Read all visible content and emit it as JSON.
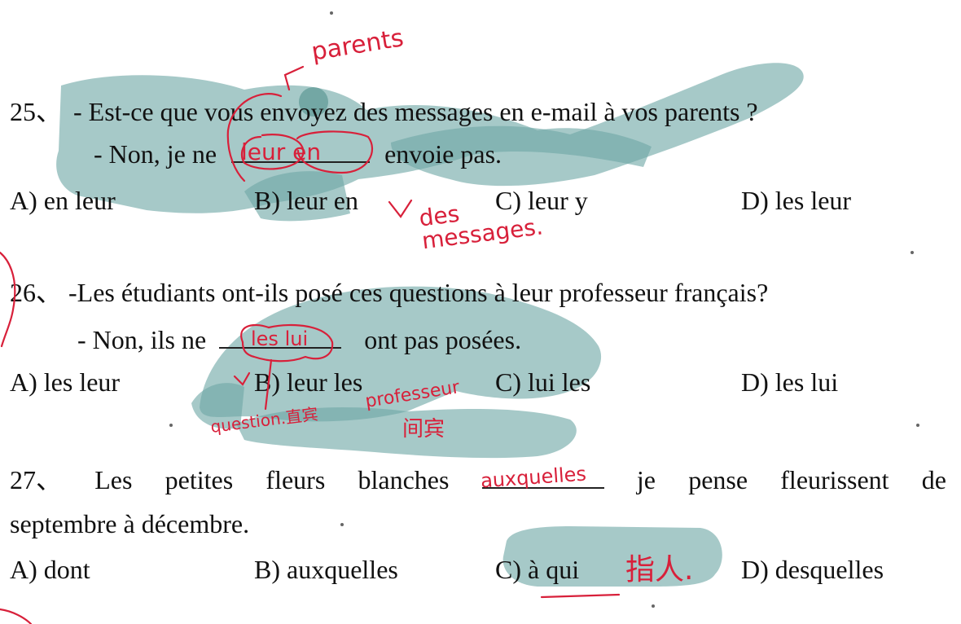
{
  "questions": [
    {
      "number": "25、",
      "line1": "- Est-ce que vous envoyez des messages en e-mail à vos parents ?",
      "line2_start": "- Non, je ne",
      "line2_end": "envoie pas.",
      "options": [
        "A) en leur",
        "B) leur en",
        "C) leur y",
        "D) les leur"
      ]
    },
    {
      "number": "26、",
      "line1": "-Les étudiants ont-ils posé ces questions à leur professeur français?",
      "line2_start": "- Non, ils ne",
      "line2_end": "ont pas posées.",
      "options": [
        "A) les leur",
        "B) leur les",
        "C) lui les",
        "D) les lui"
      ]
    },
    {
      "number": "27、",
      "line1_words": [
        "Les",
        "petites",
        "fleurs",
        "blanches",
        "je",
        "pense",
        "fleurissent",
        "de"
      ],
      "line2": "septembre à décembre.",
      "options": [
        "A) dont",
        "B) auxquelles",
        "C) à qui",
        "D) desquelles"
      ]
    }
  ],
  "annotations": {
    "q25_top": "parents",
    "q25_blank": "leur en",
    "q25_below": "des messages.",
    "q26_blank": "les lui",
    "q26_left": "question.直宾",
    "q26_right": "professeur",
    "q26_right2": "间宾",
    "q27_blank": "auxquelles",
    "q27_c": "指人."
  },
  "colors": {
    "highlight": "#6fa8a6",
    "ink": "#d8203a",
    "text": "#111111"
  }
}
